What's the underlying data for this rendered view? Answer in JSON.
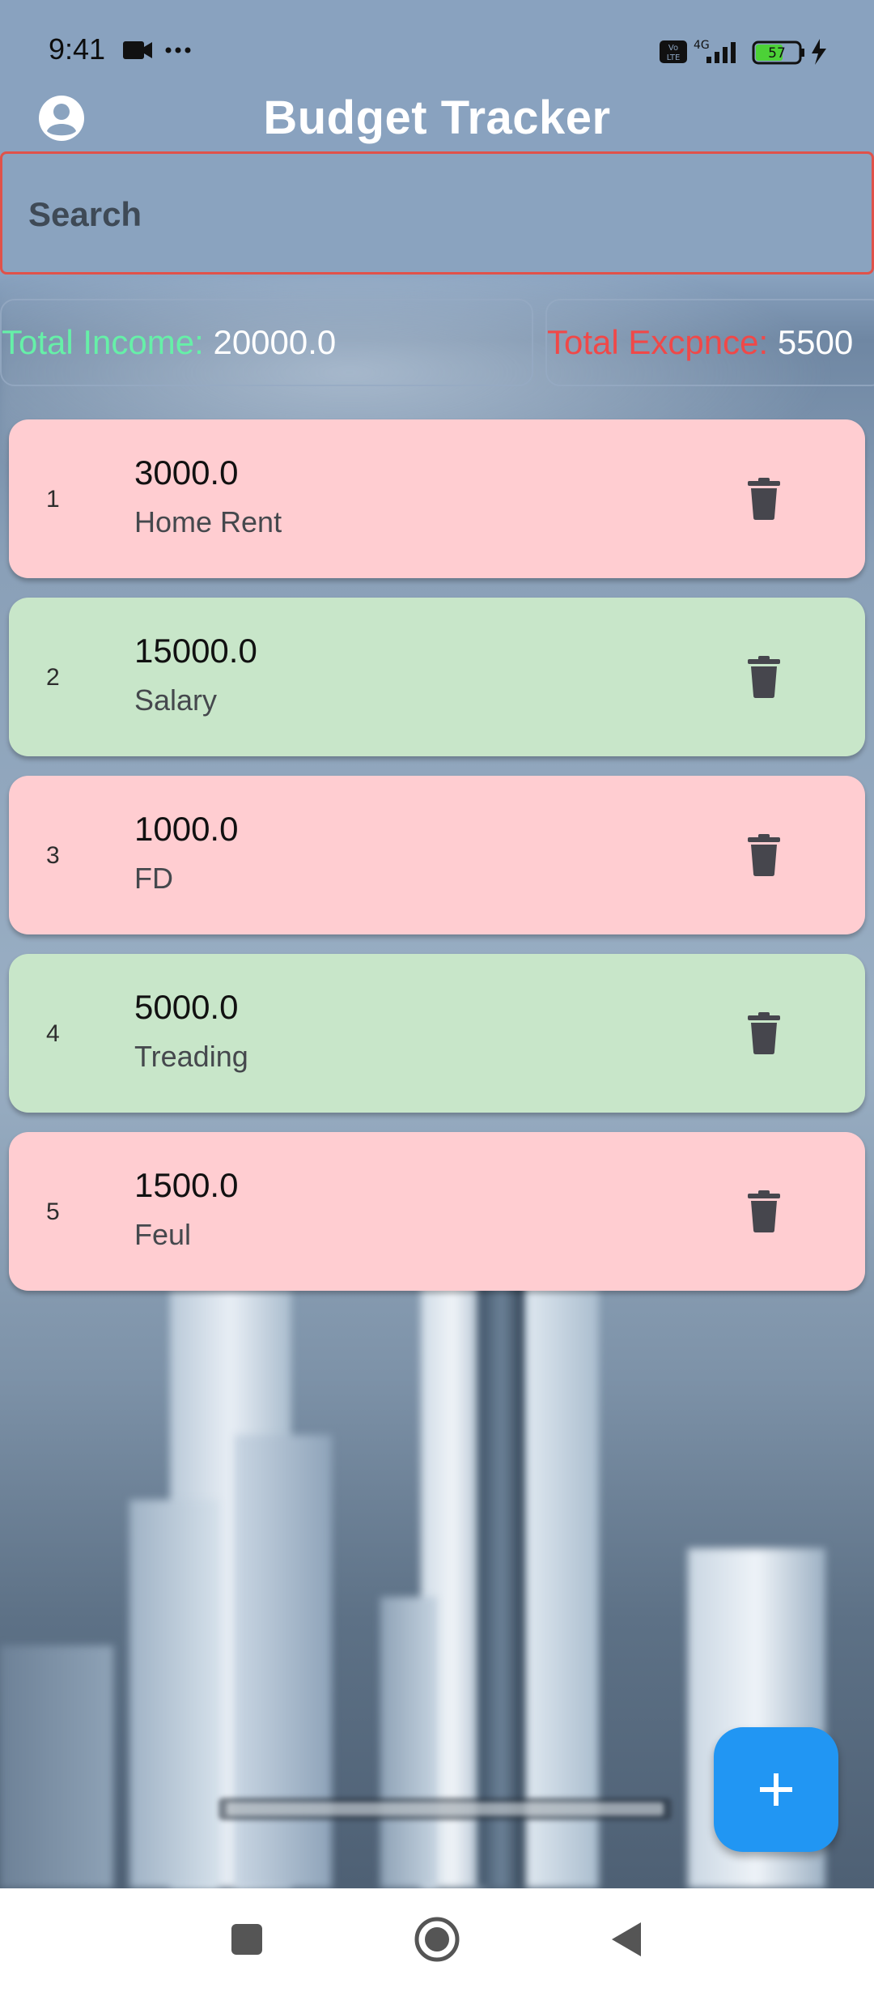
{
  "status_bar": {
    "time": "9:41",
    "more_dots": "···",
    "network": "4G",
    "volte": "Vo LTE",
    "battery": "57"
  },
  "app": {
    "title": "Budget Tracker"
  },
  "search": {
    "placeholder": "Search",
    "value": ""
  },
  "totals": {
    "income_label": "Total Income:",
    "income_value": "20000.0",
    "expense_label": "Total Excpnce:",
    "expense_value": "5500"
  },
  "transactions": [
    {
      "index": "1",
      "amount": "3000.0",
      "category": "Home Rent",
      "kind": "expense"
    },
    {
      "index": "2",
      "amount": "15000.0",
      "category": "Salary",
      "kind": "income"
    },
    {
      "index": "3",
      "amount": "1000.0",
      "category": "FD",
      "kind": "expense"
    },
    {
      "index": "4",
      "amount": "5000.0",
      "category": "Treading",
      "kind": "income"
    },
    {
      "index": "5",
      "amount": "1500.0",
      "category": "Feul",
      "kind": "expense"
    }
  ],
  "colors": {
    "income_card": "#c8e6c9",
    "expense_card": "#ffcdd1",
    "income_label": "#66f0a8",
    "expense_label": "#f04848",
    "fab": "#2196f3",
    "search_border": "#e0524a"
  },
  "icons": {
    "avatar": "account-circle-icon",
    "delete": "trash-icon",
    "fab": "plus-icon",
    "nav_recents": "square-icon",
    "nav_home": "circle-icon",
    "nav_back": "triangle-back-icon"
  }
}
